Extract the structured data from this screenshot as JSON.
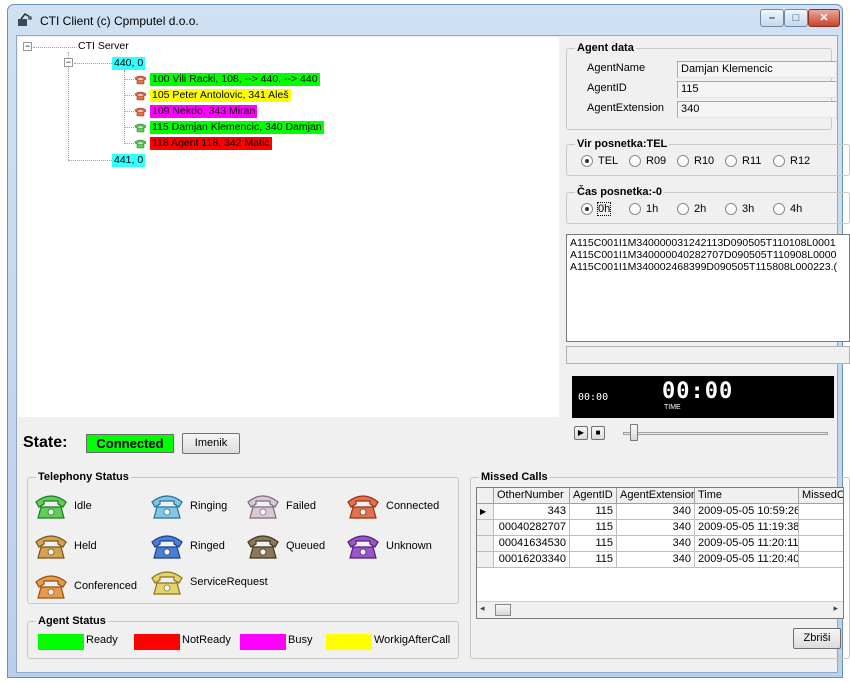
{
  "window": {
    "title": "CTI Client (c) Cpmputel d.o.o."
  },
  "colors": {
    "ready": "#00ff00",
    "not_ready": "#ff0000",
    "busy": "#ff00ff",
    "work_after_call": "#ffff00",
    "queue": "#33ffff"
  },
  "tree": {
    "root": "CTI Server",
    "queue1": "440, 0",
    "queue2": "441, 0",
    "agents": [
      {
        "label": "100  Vili Racki, 108, --> 440, --> 440",
        "color": "#00ff00",
        "phone_icon": "connected-phone-icon"
      },
      {
        "label": "105 Peter Antolovic, 341 Aleš",
        "color": "#ffff00",
        "phone_icon": "connected-phone-icon"
      },
      {
        "label": "109 Nekdo, 343 Miran",
        "color": "#ff00ff",
        "phone_icon": "connected-phone-icon"
      },
      {
        "label": "115 Damjan Klemencic, 340 Damjan",
        "color": "#00ff00",
        "phone_icon": "idle-phone-icon"
      },
      {
        "label": "118 Agent 118, 342 Matic",
        "color": "#ff0000",
        "phone_icon": "idle-phone-icon"
      }
    ]
  },
  "agent_data": {
    "title": "Agent data",
    "name_label": "AgentName",
    "name_value": "Damjan Klemencic",
    "id_label": "AgentID",
    "id_value": "115",
    "ext_label": "AgentExtension",
    "ext_value": "340"
  },
  "vir_posnetka": {
    "title": "Vir posnetka:TEL",
    "options": [
      "TEL",
      "R09",
      "R10",
      "R11",
      "R12"
    ],
    "selected": "TEL"
  },
  "cas_posnetka": {
    "title": "Čas posnetka:-0",
    "options": [
      "0h",
      "1h",
      "2h",
      "3h",
      "4h"
    ],
    "selected": "0h"
  },
  "recordings": [
    "A115C001I1M340000031242113D090505T110108L0001",
    "A115C001I1M340000040282707D090505T110908L0000",
    "A115C001I1M340002468399D090505T115808L000223.("
  ],
  "player": {
    "position": "00:00",
    "time": "00:00",
    "time_label": "TIME"
  },
  "state": {
    "label": "State:",
    "value": "Connected",
    "imenik_button": "Imenik"
  },
  "telephony_status": {
    "title": "Telephony Status",
    "items": [
      {
        "label": "Idle",
        "icon": "idle-phone-icon"
      },
      {
        "label": "Ringing",
        "icon": "ringing-phone-icon"
      },
      {
        "label": "Failed",
        "icon": "failed-phone-icon"
      },
      {
        "label": "Connected",
        "icon": "connected-phone-icon"
      },
      {
        "label": "Held",
        "icon": "held-phone-icon"
      },
      {
        "label": "Ringed",
        "icon": "ringed-phone-icon"
      },
      {
        "label": "Queued",
        "icon": "queued-phone-icon"
      },
      {
        "label": "Unknown",
        "icon": "unknown-phone-icon"
      },
      {
        "label": "Conferenced",
        "icon": "conferenced-phone-icon"
      },
      {
        "label": "ServiceRequest",
        "icon": "service-request-phone-icon"
      }
    ]
  },
  "agent_status": {
    "title": "Agent Status",
    "items": [
      {
        "label": "Ready",
        "color": "#00ff00"
      },
      {
        "label": "NotReady",
        "color": "#ff0000"
      },
      {
        "label": "Busy",
        "color": "#ff00ff"
      },
      {
        "label": "WorkigAfterCall",
        "color": "#ffff00"
      }
    ]
  },
  "missed_calls": {
    "title": "Missed Calls",
    "columns": [
      "OtherNumber",
      "AgentID",
      "AgentExtension",
      "Time",
      "MissedC"
    ],
    "rows": [
      [
        "343",
        "115",
        "340",
        "2009-05-05 10:59:26"
      ],
      [
        "00040282707",
        "115",
        "340",
        "2009-05-05 11:19:38"
      ],
      [
        "00041634530",
        "115",
        "340",
        "2009-05-05 11:20:11"
      ],
      [
        "00016203340",
        "115",
        "340",
        "2009-05-05 11:20:40"
      ]
    ],
    "delete_button": "Zbriši"
  }
}
